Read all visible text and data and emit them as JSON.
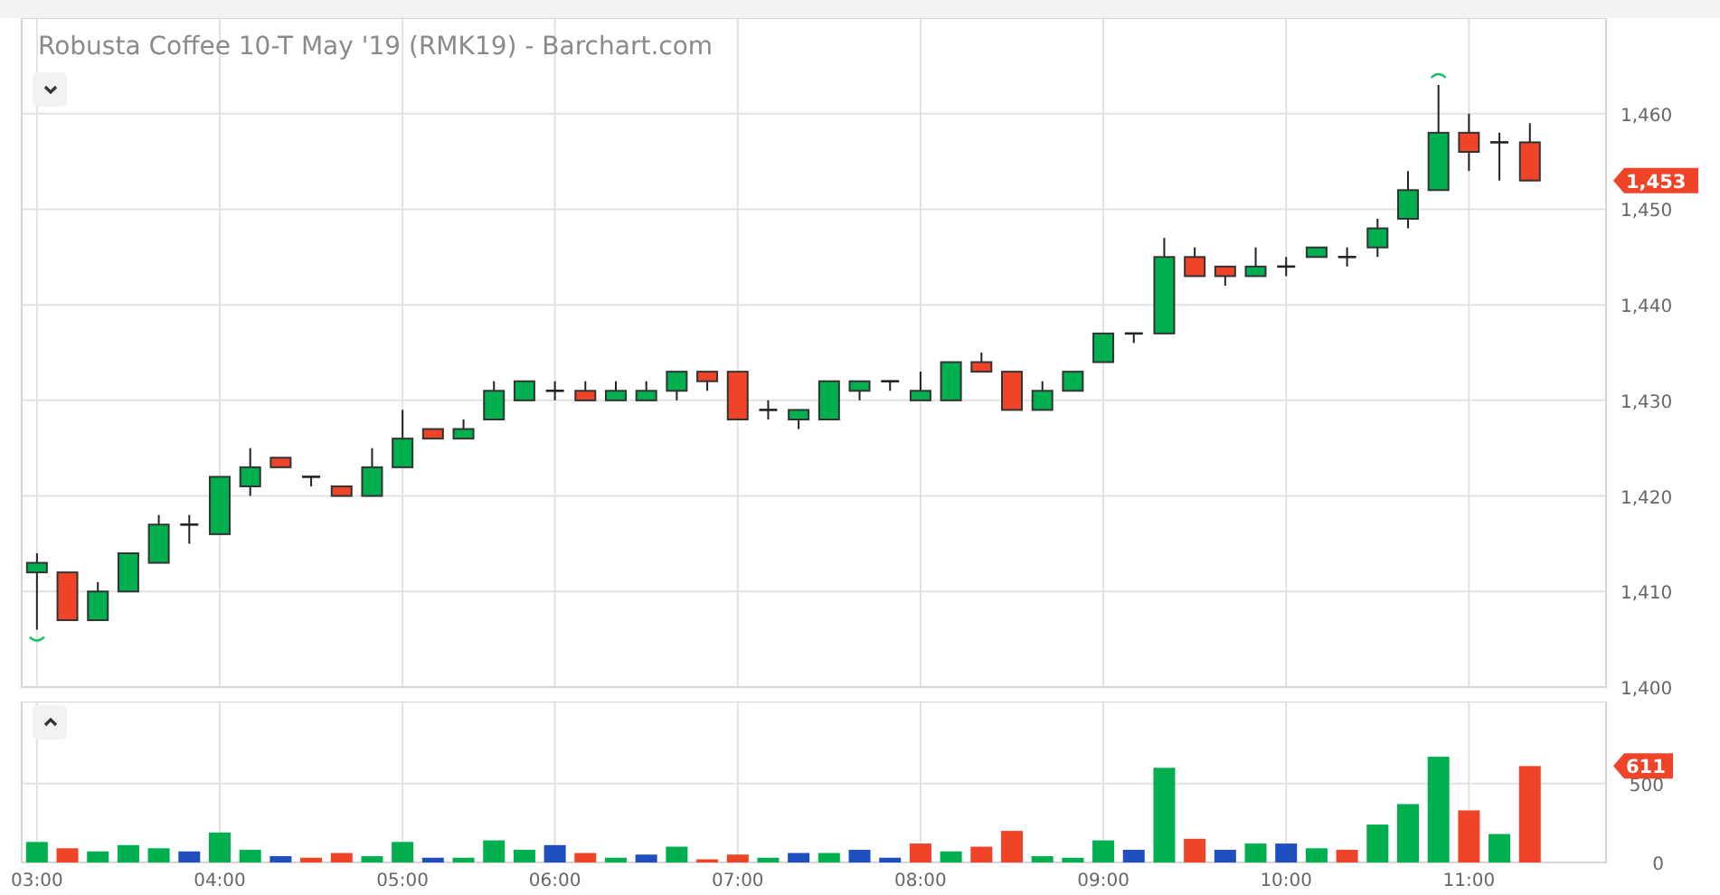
{
  "title": "Robusta Coffee 10-T May '19 (RMK19) - Barchart.com",
  "price_panel": {
    "chart_data": {
      "type": "candlestick",
      "ylim": [
        1400,
        1470
      ],
      "grid": true,
      "categories": [
        null,
        null,
        null,
        null,
        null,
        null,
        null,
        null,
        null,
        null,
        null,
        null,
        null,
        null,
        null,
        null,
        null,
        null,
        null,
        null,
        null,
        null,
        null,
        null,
        null,
        null,
        null,
        null,
        null,
        null,
        null,
        null,
        null,
        null,
        null,
        null,
        null,
        null,
        null,
        null,
        null,
        null,
        null,
        null,
        null,
        null,
        null,
        null,
        null,
        null
      ],
      "yticks": [
        {
          "value": 1400,
          "label": "1,400"
        },
        {
          "value": 1410,
          "label": "1,410"
        },
        {
          "value": 1420,
          "label": "1,420"
        },
        {
          "value": 1430,
          "label": "1,430"
        },
        {
          "value": 1440,
          "label": "1,440"
        },
        {
          "value": 1450,
          "label": "1,450"
        },
        {
          "value": 1460,
          "label": "1,460"
        }
      ],
      "ohlc": [
        [
          1412,
          1414,
          1406,
          1413
        ],
        [
          1412,
          1412,
          1407,
          1407
        ],
        [
          1407,
          1411,
          1407,
          1410
        ],
        [
          1410,
          1414,
          1410,
          1414
        ],
        [
          1413,
          1418,
          1413,
          1417
        ],
        [
          1417,
          1418,
          1415,
          1417
        ],
        [
          1416,
          1422,
          1416,
          1422
        ],
        [
          1421,
          1425,
          1420,
          1423
        ],
        [
          1424,
          1424,
          1423,
          1423
        ],
        [
          1422,
          1422,
          1421,
          1422
        ],
        [
          1421,
          1421,
          1420,
          1420
        ],
        [
          1420,
          1425,
          1420,
          1423
        ],
        [
          1423,
          1429,
          1423,
          1426
        ],
        [
          1427,
          1427,
          1426,
          1426
        ],
        [
          1426,
          1428,
          1426,
          1427
        ],
        [
          1428,
          1432,
          1428,
          1431
        ],
        [
          1430,
          1432,
          1430,
          1432
        ],
        [
          1431,
          1432,
          1430,
          1431
        ],
        [
          1431,
          1432,
          1430,
          1430
        ],
        [
          1430,
          1432,
          1430,
          1431
        ],
        [
          1430,
          1432,
          1430,
          1431
        ],
        [
          1431,
          1433,
          1430,
          1433
        ],
        [
          1433,
          1433,
          1431,
          1432
        ],
        [
          1433,
          1433,
          1428,
          1428
        ],
        [
          1429,
          1430,
          1428,
          1429
        ],
        [
          1428,
          1429,
          1427,
          1429
        ],
        [
          1428,
          1432,
          1428,
          1432
        ],
        [
          1431,
          1432,
          1430,
          1432
        ],
        [
          1432,
          1432,
          1431,
          1432
        ],
        [
          1430,
          1433,
          1430,
          1431
        ],
        [
          1430,
          1434,
          1430,
          1434
        ],
        [
          1434,
          1435,
          1433,
          1433
        ],
        [
          1433,
          1433,
          1429,
          1429
        ],
        [
          1429,
          1432,
          1429,
          1431
        ],
        [
          1431,
          1433,
          1431,
          1433
        ],
        [
          1434,
          1437,
          1434,
          1437
        ],
        [
          1437,
          1437,
          1436,
          1437
        ],
        [
          1437,
          1447,
          1437,
          1445
        ],
        [
          1445,
          1446,
          1443,
          1443
        ],
        [
          1444,
          1444,
          1442,
          1443
        ],
        [
          1443,
          1446,
          1443,
          1444
        ],
        [
          1444,
          1445,
          1443,
          1444
        ],
        [
          1445,
          1446,
          1445,
          1446
        ],
        [
          1445,
          1446,
          1444,
          1445
        ],
        [
          1446,
          1449,
          1445,
          1448
        ],
        [
          1449,
          1454,
          1448,
          1452
        ],
        [
          1452,
          1463,
          1452,
          1458
        ],
        [
          1458,
          1460,
          1454,
          1456
        ],
        [
          1457,
          1458,
          1453,
          1457
        ],
        [
          1457,
          1459,
          1453,
          1453
        ]
      ],
      "annotations": [
        "1,453"
      ]
    }
  },
  "volume_panel": {
    "chart_data": {
      "type": "bar",
      "orientation": "vertical",
      "ylim": [
        0,
        1020
      ],
      "grid": true,
      "categories": [
        "03:00",
        null,
        null,
        null,
        null,
        null,
        "04:00",
        null,
        null,
        null,
        null,
        null,
        "05:00",
        null,
        null,
        null,
        null,
        "06:00",
        null,
        null,
        null,
        null,
        null,
        "07:00",
        null,
        null,
        null,
        null,
        null,
        "08:00",
        null,
        null,
        null,
        null,
        null,
        "09:00",
        null,
        null,
        null,
        null,
        null,
        "10:00",
        null,
        null,
        null,
        null,
        null,
        "11:00",
        null,
        null
      ],
      "yticks": [
        0,
        500
      ],
      "series": [
        {
          "color": "#00b04f",
          "values": [
            130,
            null,
            70,
            110,
            90,
            null,
            190,
            80,
            null,
            null,
            null,
            40,
            130,
            null,
            30,
            140,
            80,
            null,
            null,
            30,
            null,
            100,
            null,
            null,
            30,
            null,
            60,
            null,
            null,
            null,
            70,
            null,
            null,
            40,
            30,
            140,
            null,
            600,
            null,
            null,
            120,
            null,
            90,
            null,
            240,
            370,
            670,
            null,
            180,
            null
          ]
        },
        {
          "color": "#f04428",
          "values": [
            null,
            90,
            null,
            null,
            null,
            null,
            null,
            null,
            null,
            30,
            60,
            null,
            null,
            null,
            null,
            null,
            null,
            null,
            60,
            null,
            null,
            null,
            20,
            50,
            null,
            null,
            null,
            null,
            null,
            120,
            null,
            100,
            200,
            null,
            null,
            null,
            null,
            null,
            150,
            null,
            null,
            null,
            null,
            80,
            null,
            null,
            null,
            330,
            null,
            611
          ]
        },
        {
          "color": "#1f4fbf",
          "values": [
            null,
            null,
            null,
            null,
            null,
            70,
            null,
            null,
            40,
            null,
            null,
            null,
            null,
            30,
            null,
            null,
            null,
            110,
            null,
            null,
            50,
            null,
            null,
            null,
            null,
            60,
            null,
            80,
            30,
            null,
            null,
            null,
            null,
            null,
            null,
            null,
            80,
            null,
            null,
            80,
            null,
            120,
            null,
            null,
            null,
            null,
            null,
            null,
            null,
            null
          ]
        }
      ],
      "annotations": [
        "611"
      ]
    }
  }
}
